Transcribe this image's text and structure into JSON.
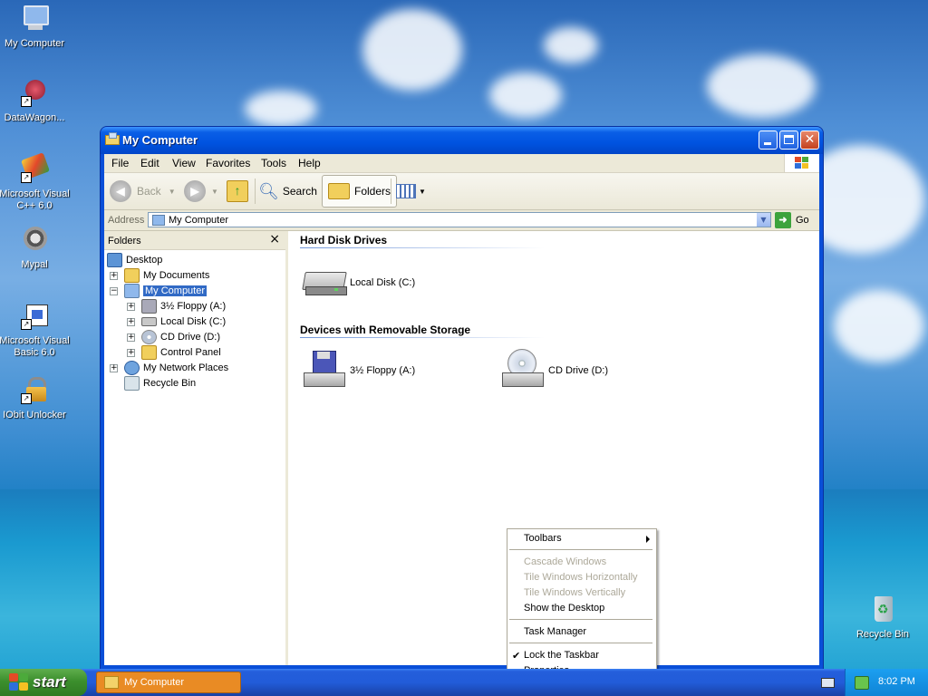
{
  "desktop": {
    "icons": [
      {
        "label": "My Computer"
      },
      {
        "label": "DataWagon..."
      },
      {
        "label": "Microsoft Visual C++ 6.0"
      },
      {
        "label": "Mypal"
      },
      {
        "label": "Microsoft Visual Basic 6.0"
      },
      {
        "label": "IObit Unlocker"
      },
      {
        "label": "Recycle Bin"
      }
    ]
  },
  "window": {
    "title": "My Computer",
    "menu": [
      "File",
      "Edit",
      "View",
      "Favorites",
      "Tools",
      "Help"
    ],
    "toolbar": {
      "back": "Back",
      "search": "Search",
      "folders": "Folders"
    },
    "address": {
      "label": "Address",
      "value": "My Computer",
      "go": "Go"
    },
    "folders_pane": {
      "title": "Folders",
      "close": "×",
      "tree": [
        {
          "label": "Desktop"
        },
        {
          "label": "My Documents"
        },
        {
          "label": "My Computer"
        },
        {
          "label": "3½ Floppy (A:)"
        },
        {
          "label": "Local Disk (C:)"
        },
        {
          "label": "CD Drive (D:)"
        },
        {
          "label": "Control Panel"
        },
        {
          "label": "My Network Places"
        },
        {
          "label": "Recycle Bin"
        }
      ]
    },
    "content": {
      "groups": [
        {
          "title": "Hard Disk Drives",
          "items": [
            "Local Disk (C:)"
          ]
        },
        {
          "title": "Devices with Removable Storage",
          "items": [
            "3½ Floppy (A:)",
            "CD Drive (D:)"
          ]
        }
      ]
    }
  },
  "context_menu": {
    "items": [
      {
        "label": "Toolbars",
        "submenu": true,
        "enabled": true
      },
      {
        "label": "Cascade Windows",
        "enabled": false
      },
      {
        "label": "Tile Windows Horizontally",
        "enabled": false
      },
      {
        "label": "Tile Windows Vertically",
        "enabled": false
      },
      {
        "label": "Show the Desktop",
        "enabled": true
      },
      {
        "label": "Task Manager",
        "enabled": true
      },
      {
        "label": "Lock the Taskbar",
        "checked": true,
        "enabled": true
      },
      {
        "label": "Properties",
        "enabled": true
      }
    ]
  },
  "taskbar": {
    "start": "start",
    "task": "My Computer",
    "clock": "8:02 PM"
  },
  "colors": {
    "selection": "#316ac5",
    "taskbar": "#245edb",
    "start": "#3c8f2d",
    "active_task": "#e98b24"
  }
}
